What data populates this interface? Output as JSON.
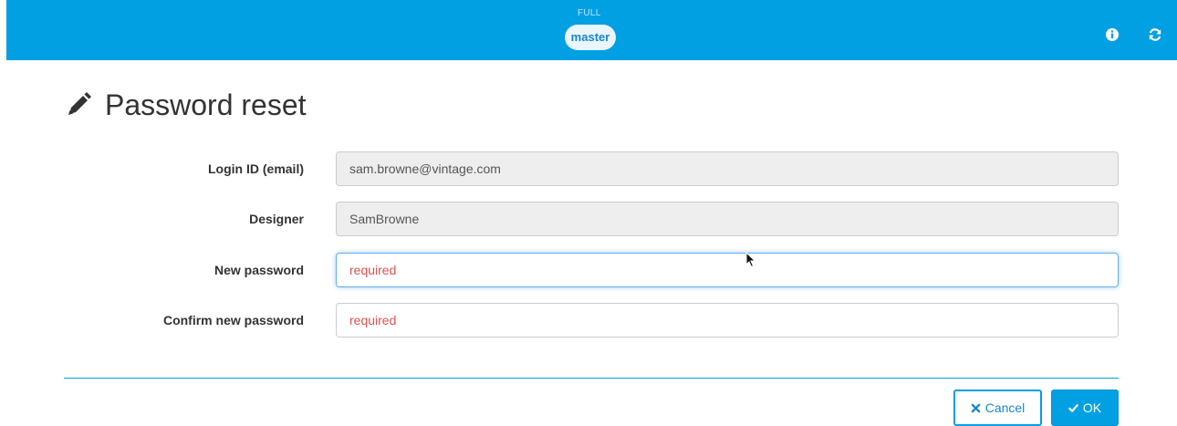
{
  "header": {
    "env_label": "FULL",
    "branch": "master",
    "icons": [
      "info-icon",
      "refresh-icon"
    ]
  },
  "page": {
    "title": "Password reset",
    "title_icon": "pencil-icon"
  },
  "form": {
    "login": {
      "label": "Login ID (email)",
      "value": "sam.browne@vintage.com"
    },
    "designer": {
      "label": "Designer",
      "value": "SamBrowne"
    },
    "new_password": {
      "label": "New password",
      "placeholder": "required"
    },
    "confirm_password": {
      "label": "Confirm new password",
      "placeholder": "required"
    }
  },
  "actions": {
    "cancel_label": "Cancel",
    "cancel_icon": "times-icon",
    "ok_label": "OK",
    "ok_icon": "check-icon"
  },
  "colors": {
    "accent": "#00a0e3",
    "placeholder_required": "#d9534f",
    "readonly_bg": "#eeeeee"
  }
}
